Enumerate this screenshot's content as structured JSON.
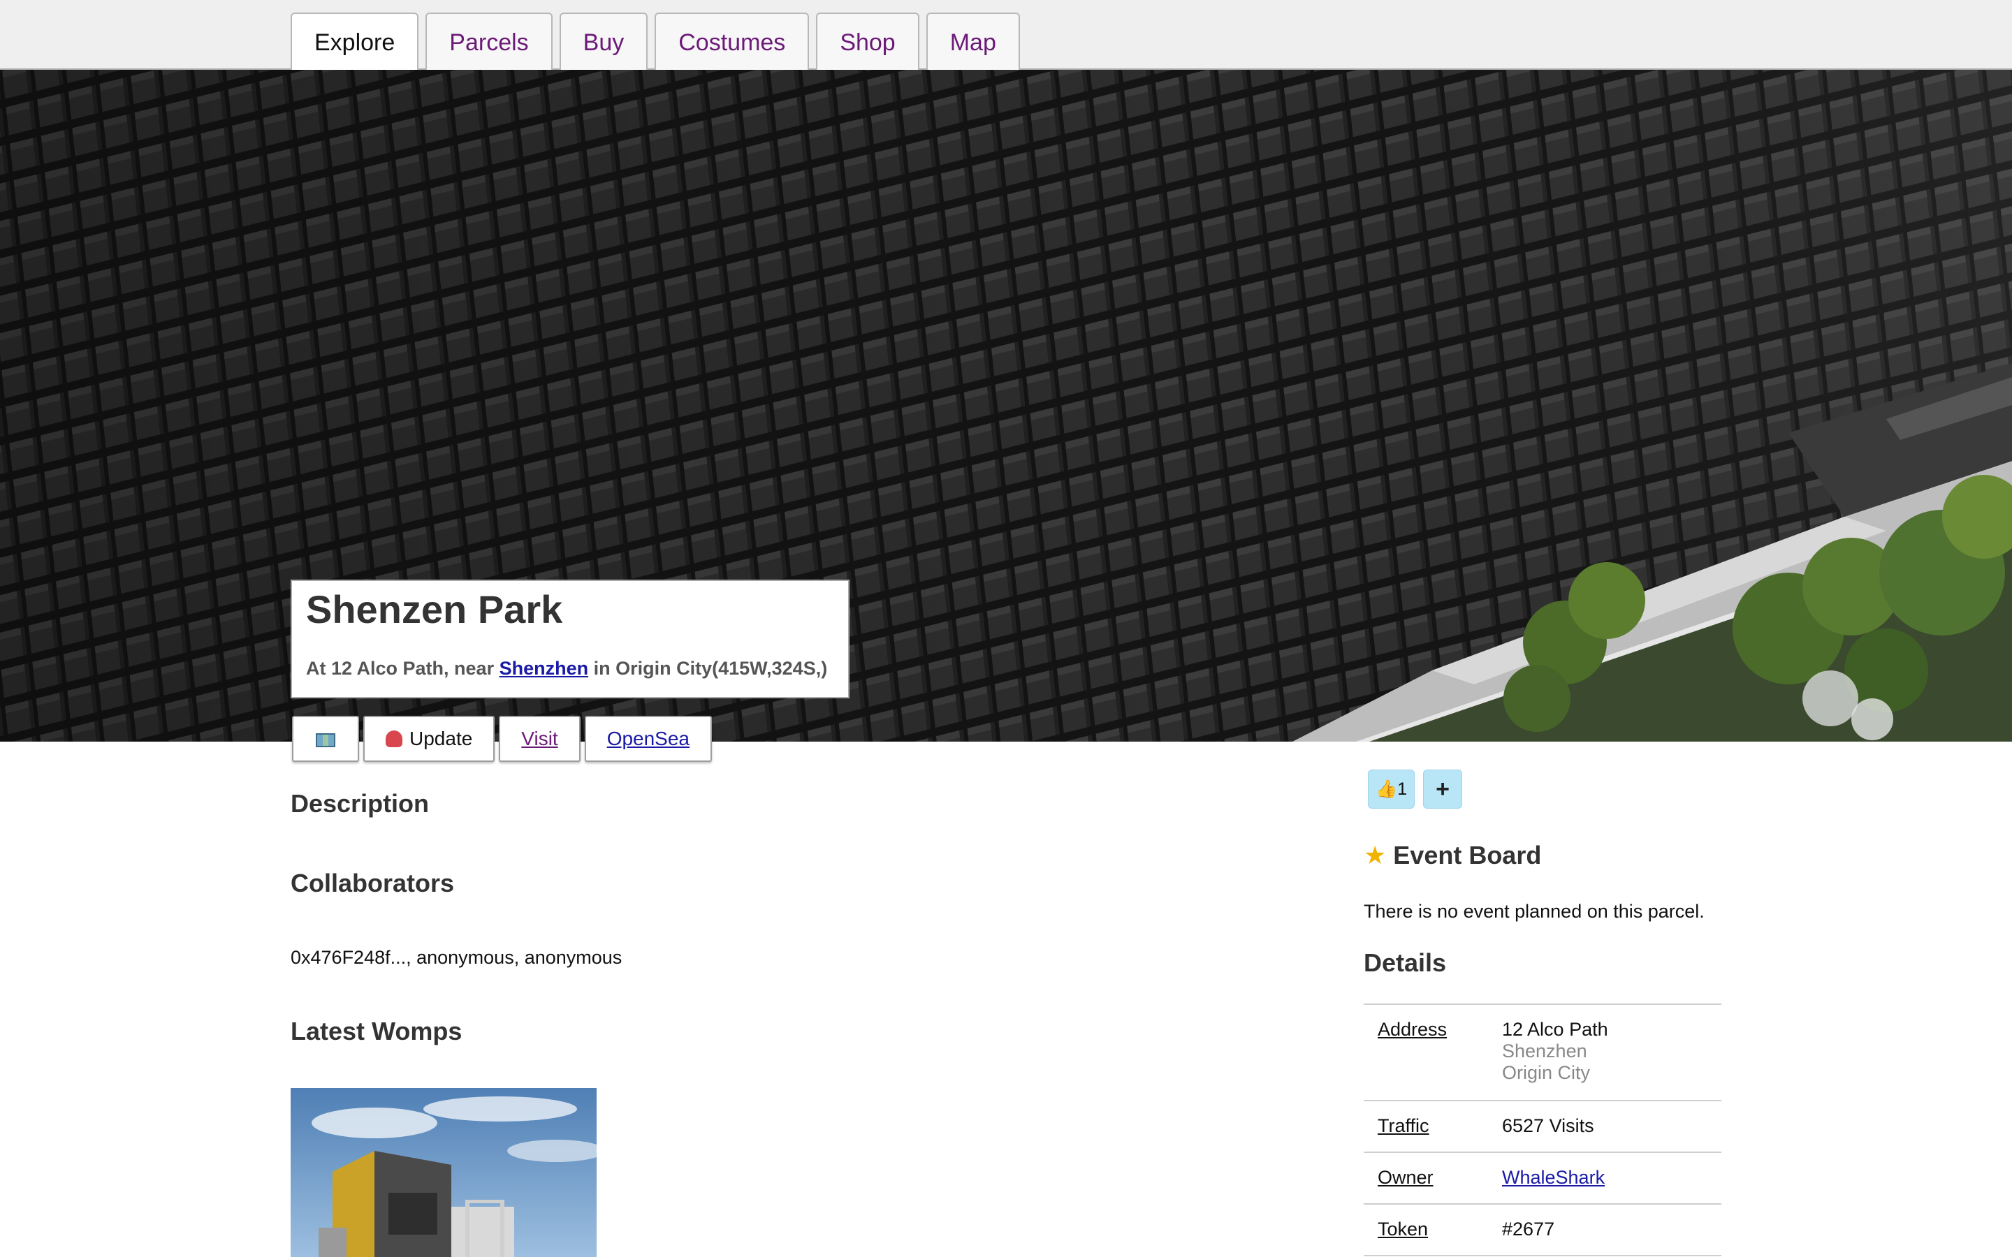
{
  "nav": {
    "tabs": [
      {
        "label": "Explore",
        "active": true
      },
      {
        "label": "Parcels"
      },
      {
        "label": "Buy"
      },
      {
        "label": "Costumes"
      },
      {
        "label": "Shop"
      },
      {
        "label": "Map"
      }
    ]
  },
  "parcel": {
    "name": "Shenzen Park",
    "location_prefix": "At 12 Alco Path, near ",
    "suburb_link": "Shenzhen",
    "location_suffix": " in Origin City(415W,324S,)"
  },
  "actions": {
    "map_icon": "map-icon",
    "update_label": "Update",
    "update_icon": "octopus-icon",
    "visit_label": "Visit",
    "opensea_label": "OpenSea"
  },
  "sections": {
    "description_heading": "Description",
    "collaborators_heading": "Collaborators",
    "collaborators_text": "0x476F248f..., anonymous, anonymous",
    "womps_heading": "Latest Womps"
  },
  "reactions": {
    "like_icon": "thumbs-up-icon",
    "like_count": "1",
    "add_label": "+"
  },
  "event_board": {
    "icon": "star-icon",
    "heading": "Event Board",
    "empty_text": "There is no event planned on this parcel."
  },
  "details": {
    "heading": "Details",
    "address_label": "Address",
    "address_line1": "12 Alco Path",
    "address_line2": "Shenzhen",
    "address_line3": "Origin City",
    "traffic_label": "Traffic",
    "traffic_value": "6527 Visits",
    "owner_label": "Owner",
    "owner_value": "WhaleShark",
    "token_label": "Token",
    "token_value": "#2677"
  },
  "colors": {
    "tab_link": "#6c1a78",
    "link_blue": "#1a1aa6",
    "reaction_bg": "#b9e6f7",
    "topbar_bg": "#efefef"
  }
}
